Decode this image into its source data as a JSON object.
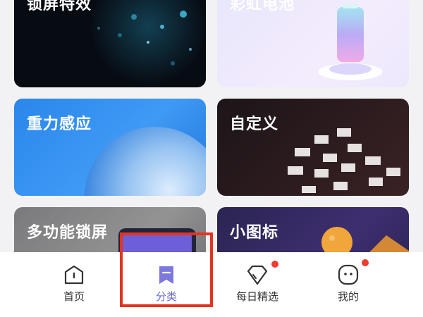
{
  "cards": [
    {
      "title": "锁屏特效"
    },
    {
      "title": "彩虹电池"
    },
    {
      "title": "重力感应"
    },
    {
      "title": "自定义"
    },
    {
      "title": "多功能锁屏"
    },
    {
      "title": "小图标"
    }
  ],
  "bottom_nav": {
    "items": [
      {
        "label": "首页",
        "icon": "home-icon",
        "active": false
      },
      {
        "label": "分类",
        "icon": "category-bookmark-icon",
        "active": true
      },
      {
        "label": "每日精选",
        "icon": "diamond-tag-icon",
        "active": false,
        "badge_dot": true
      },
      {
        "label": "我的",
        "icon": "face-icon",
        "active": false,
        "badge_dot": true
      }
    ]
  },
  "colors": {
    "accent": "#6a6ad6",
    "badge": "#f03b2f",
    "highlight": "#e6331f"
  }
}
